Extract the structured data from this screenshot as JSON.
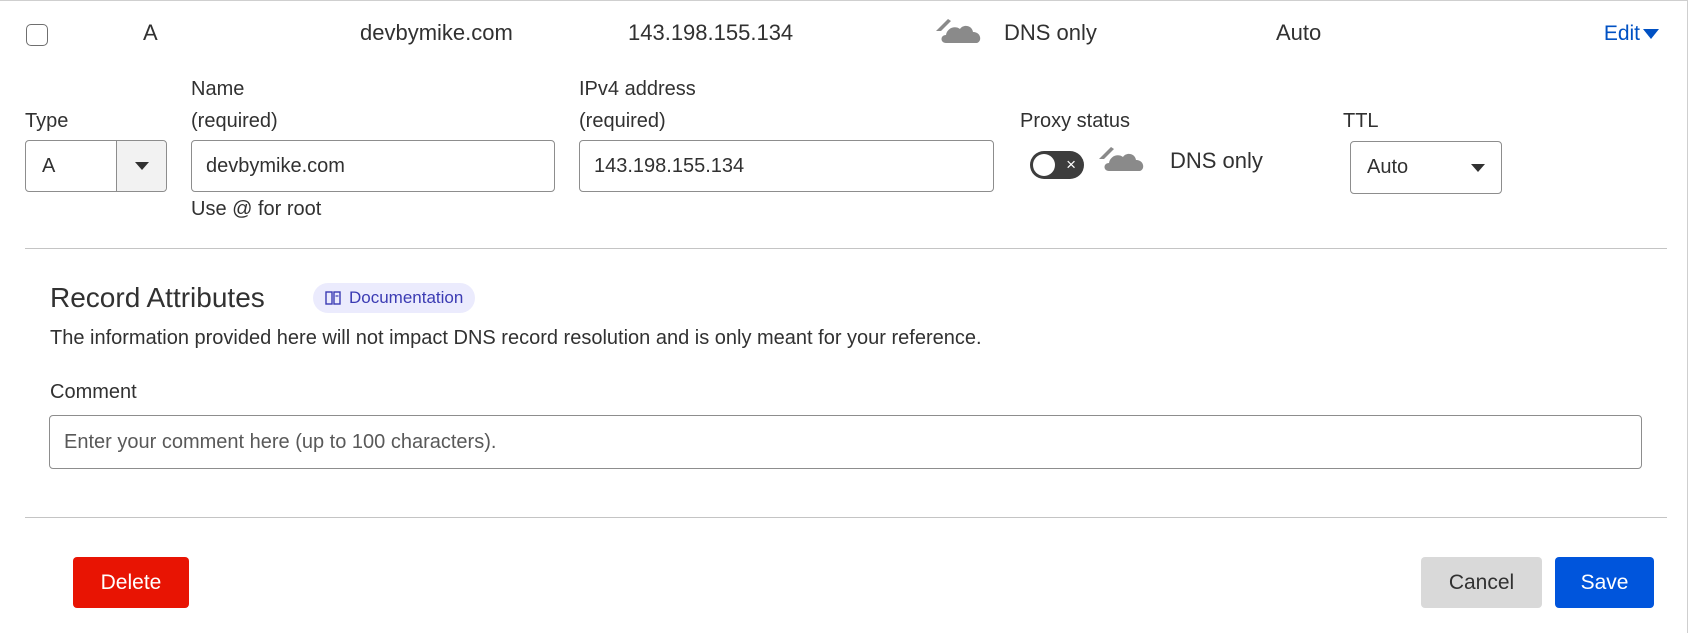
{
  "record": {
    "type": "A",
    "name": "devbymike.com",
    "content": "143.198.155.134",
    "proxy_status": "DNS only",
    "ttl": "Auto",
    "edit_label": "Edit"
  },
  "form": {
    "type_label": "Type",
    "type_value": "A",
    "name_label_line1": "Name",
    "name_label_line2": "(required)",
    "name_value": "devbymike.com",
    "name_hint": "Use @ for root",
    "ipv4_label_line1": "IPv4 address",
    "ipv4_label_line2": "(required)",
    "ipv4_value": "143.198.155.134",
    "proxy_label": "Proxy status",
    "proxy_value": "DNS only",
    "proxy_enabled": false,
    "ttl_label": "TTL",
    "ttl_value": "Auto"
  },
  "attributes": {
    "title": "Record Attributes",
    "doc_label": "Documentation",
    "description": "The information provided here will not impact DNS record resolution and is only meant for your reference.",
    "comment_label": "Comment",
    "comment_placeholder": "Enter your comment here (up to 100 characters).",
    "comment_value": ""
  },
  "actions": {
    "delete_label": "Delete",
    "cancel_label": "Cancel",
    "save_label": "Save"
  },
  "colors": {
    "link": "#0051c3",
    "delete": "#e81403",
    "save": "#0055dc",
    "cancel": "#d9d9d9",
    "badge_bg": "#ebebfd",
    "badge_text": "#3b3bb3",
    "cloud_gray": "#8a8a8a"
  },
  "icons": {
    "cloud": "cloud-icon",
    "book": "book-icon",
    "caret": "caret-down-icon",
    "close": "close-icon"
  }
}
